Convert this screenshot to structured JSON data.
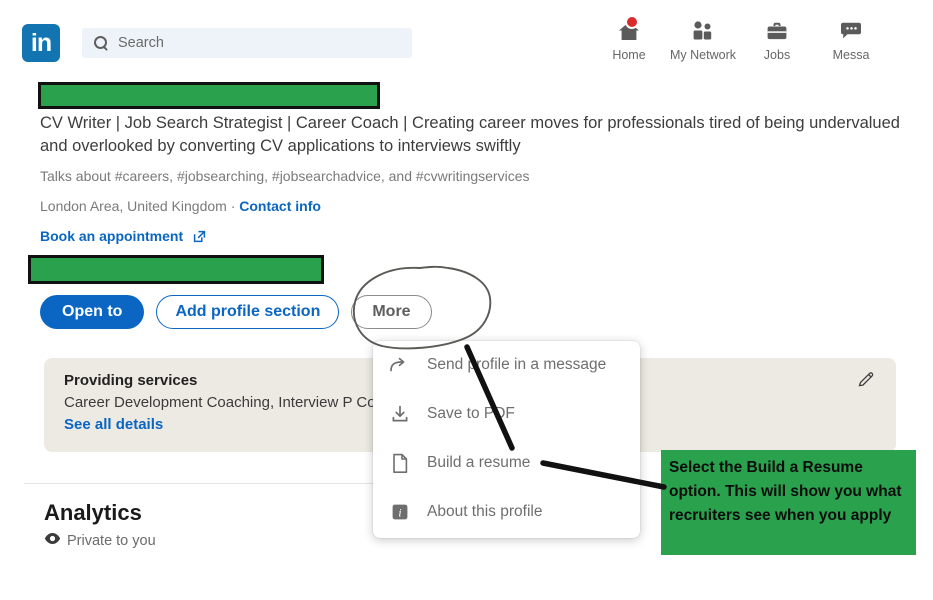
{
  "nav": {
    "logo_text": "in",
    "logo_color": "#1275b1",
    "search_placeholder": "Search",
    "search_icon": "search-icon",
    "items": [
      {
        "label": "Home",
        "icon": "home-icon",
        "has_badge": true
      },
      {
        "label": "My Network",
        "icon": "people-icon",
        "has_badge": false
      },
      {
        "label": "Jobs",
        "icon": "briefcase-icon",
        "has_badge": false
      },
      {
        "label": "Messa",
        "icon": "message-bubble-icon",
        "has_badge": false
      }
    ]
  },
  "profile": {
    "name_redacted": true,
    "headline": "CV Writer | Job Search Strategist | Career Coach | Creating career moves for professionals tired of being undervalued and overlooked by converting CV applications to interviews swiftly",
    "talks_about": "Talks about #careers, #jobsearching, #jobsearchadvice, and #cvwritingservices",
    "location": "London Area, United Kingdom",
    "location_separator": " · ",
    "contact_info_label": "Contact info",
    "booking_label": "Book an appointment",
    "booking_icon": "external-link-icon",
    "buttons": [
      {
        "label": "Open to",
        "style": "primary"
      },
      {
        "label": "Add profile section",
        "style": "outline"
      },
      {
        "label": "More",
        "style": "gray"
      }
    ]
  },
  "services": {
    "title": "Providing services",
    "body": "Career Development Coaching, Interview P                                        Corporate Training, Strategic ...",
    "link_label": "See all details",
    "edit_icon": "pencil-icon"
  },
  "dropdown": {
    "items": [
      {
        "label": "Send profile in a message",
        "icon": "share-arrow-icon"
      },
      {
        "label": "Save to PDF",
        "icon": "download-icon"
      },
      {
        "label": "Build a resume",
        "icon": "document-icon"
      },
      {
        "label": "About this profile",
        "icon": "info-icon"
      }
    ]
  },
  "analytics": {
    "title": "Analytics",
    "visibility_icon": "eye-icon",
    "visibility_label": "Private to you"
  },
  "annotation": {
    "note_text": "Select the Build a Resume option.  This will show you what recruiters see when you apply",
    "note_bg": "#2aa14c",
    "note_fg": "#0d0d0d",
    "circle_target": "More",
    "arrow_target": "Build a resume"
  },
  "colors": {
    "linkedin_blue": "#0a66c2",
    "redaction_green": "#2aa14c",
    "badge_red": "#d92b2b",
    "card_beige": "#edeae4"
  }
}
